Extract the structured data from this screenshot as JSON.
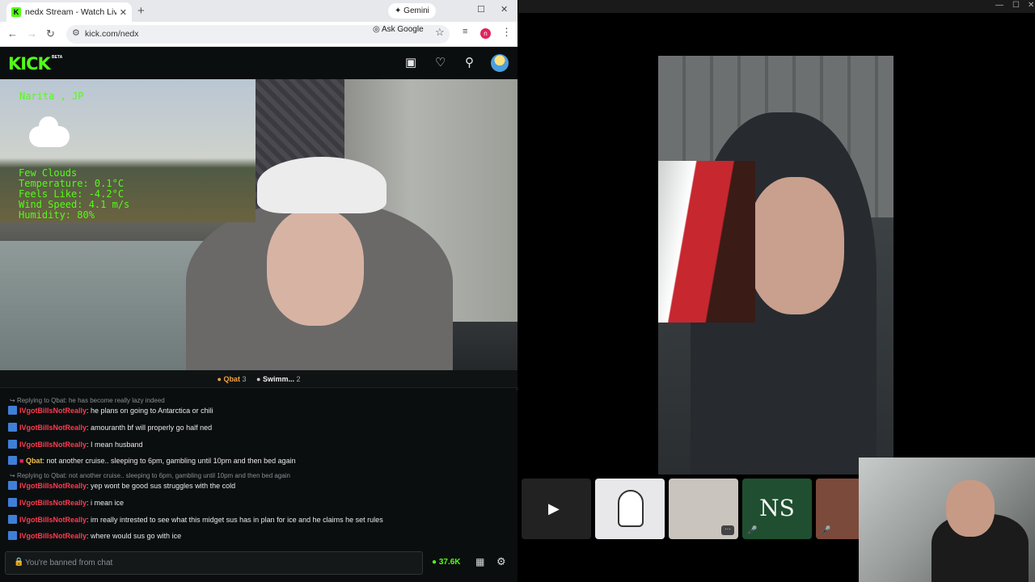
{
  "browser": {
    "tab_title": "nedx Stream - Watch Live on K",
    "tab_favicon": "K",
    "new_tab": "+",
    "gemini_label": "Gemini",
    "url": "kick.com/nedx",
    "ask_google": "Ask Google",
    "profile_initial": "n"
  },
  "kick": {
    "logo": "KICK",
    "beta": "BETA",
    "accent": "#53fc18"
  },
  "weather": {
    "city": "Narita , JP",
    "condition": "Few Clouds",
    "temperature": "Temperature: 0.1°C",
    "feels_like": "Feels Like: -4.2°C",
    "wind": "Wind Speed: 4.1 m/s",
    "humidity": "Humidity: 80%"
  },
  "pinned": {
    "items": [
      {
        "name": "Qbat",
        "count": "3"
      },
      {
        "name": "Swimm...",
        "count": "2"
      }
    ]
  },
  "chat": {
    "messages": [
      {
        "type": "reply",
        "text": "Replying to Qbat: he has become really lazy indeed"
      },
      {
        "type": "msg",
        "user": "IVgotBillsNotReally",
        "text": ": he plans on going to Antarctica or chili"
      },
      {
        "type": "msg",
        "user": "IVgotBillsNotReally",
        "text": ": amouranth bf will properly go half ned"
      },
      {
        "type": "msg",
        "user": "IVgotBillsNotReally",
        "text": ": I mean husband"
      },
      {
        "type": "msg",
        "user": "Qbat",
        "text": ": not another cruise.. sleeping to 6pm, gambling until 10pm and then bed again"
      },
      {
        "type": "reply",
        "text": "Replying to Qbat: not another cruise.. sleeping to 6pm, gambling until 10pm and then bed again"
      },
      {
        "type": "msg",
        "user": "IVgotBillsNotReally",
        "text": ": yep wont be good sus struggles with the cold"
      },
      {
        "type": "msg",
        "user": "IVgotBillsNotReally",
        "text": ": i mean ice"
      },
      {
        "type": "msg",
        "user": "IVgotBillsNotReally",
        "text": ": im really intrested to see what this midget sus has in plan for ice and he claims he set rules"
      },
      {
        "type": "msg",
        "user": "IVgotBillsNotReally",
        "text": ": where would sus go with ice"
      }
    ],
    "input_placeholder": "You're banned from chat",
    "viewers": "37.6K"
  },
  "call": {
    "tile_ns": "NS"
  }
}
